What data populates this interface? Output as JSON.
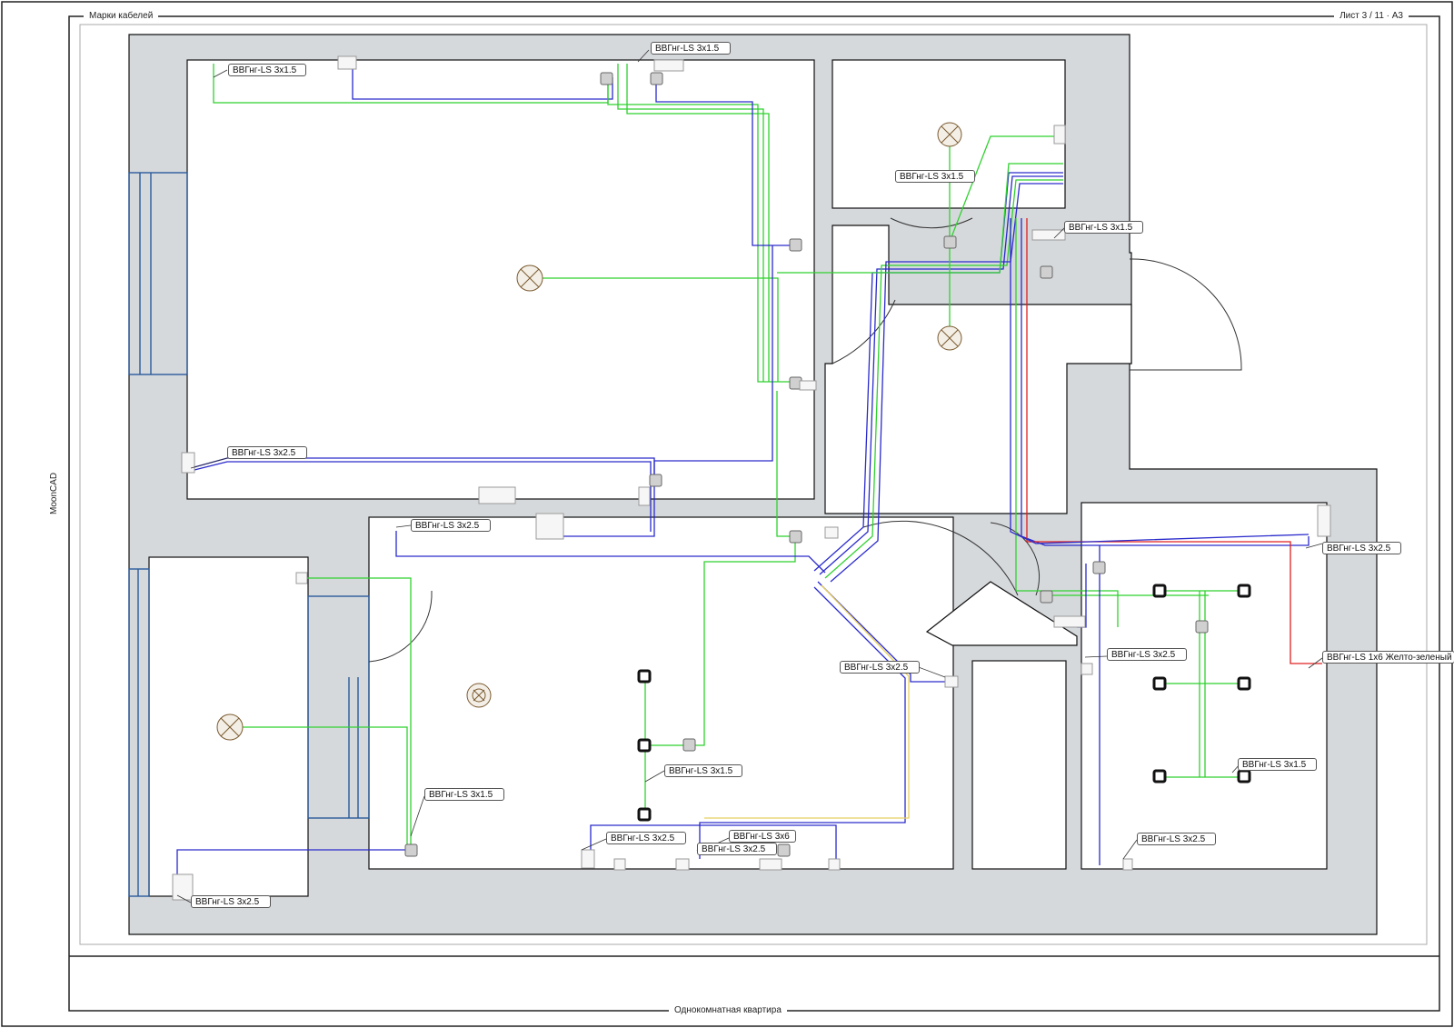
{
  "header": {
    "left_title": "Марки кабелей",
    "sheet_info": "Лист 3 / 11 · А3",
    "bottom_title": "Однокомнатная квартира",
    "side_label": "MoonCAD"
  },
  "colors": {
    "wall_fill": "#d6d9dc",
    "room_fill": "#ffffff",
    "cable_lighting": "#2fd12f",
    "cable_power": "#2a2acc",
    "cable_ground": "#e02020",
    "cable_yellow": "#e8d060",
    "window": "#2a5a9a",
    "device": "#d0d0d0"
  },
  "cable_labels": [
    {
      "id": "c1",
      "text": "ВВГнг-LS 3x1.5"
    },
    {
      "id": "c2",
      "text": "ВВГнг-LS 3x1.5"
    },
    {
      "id": "c3",
      "text": "ВВГнг-LS 3x1.5"
    },
    {
      "id": "c4",
      "text": "ВВГнг-LS 3x1.5"
    },
    {
      "id": "c5",
      "text": "ВВГнг-LS 3x2.5"
    },
    {
      "id": "c6",
      "text": "ВВГнг-LS 3x2.5"
    },
    {
      "id": "c7",
      "text": "ВВГнг-LS 3x2.5"
    },
    {
      "id": "c8",
      "text": "ВВГнг-LS 1x6 Желто-зеленый"
    },
    {
      "id": "c9",
      "text": "ВВГнг-LS 3x2.5"
    },
    {
      "id": "c10",
      "text": "ВВГнг-LS 3x2.5"
    },
    {
      "id": "c11",
      "text": "ВВГнг-LS 3x1.5"
    },
    {
      "id": "c12",
      "text": "ВВГнг-LS 3x1.5"
    },
    {
      "id": "c13",
      "text": "ВВГнг-LS 3x1.5"
    },
    {
      "id": "c14",
      "text": "ВВГнг-LS 3x2.5"
    },
    {
      "id": "c15",
      "text": "ВВГнг-LS 3x6"
    },
    {
      "id": "c16",
      "text": "ВВГнг-LS 3x2.5"
    },
    {
      "id": "c17",
      "text": "ВВГнг-LS 3x2.5"
    },
    {
      "id": "c18",
      "text": "ВВГнг-LS 3x2.5"
    }
  ]
}
